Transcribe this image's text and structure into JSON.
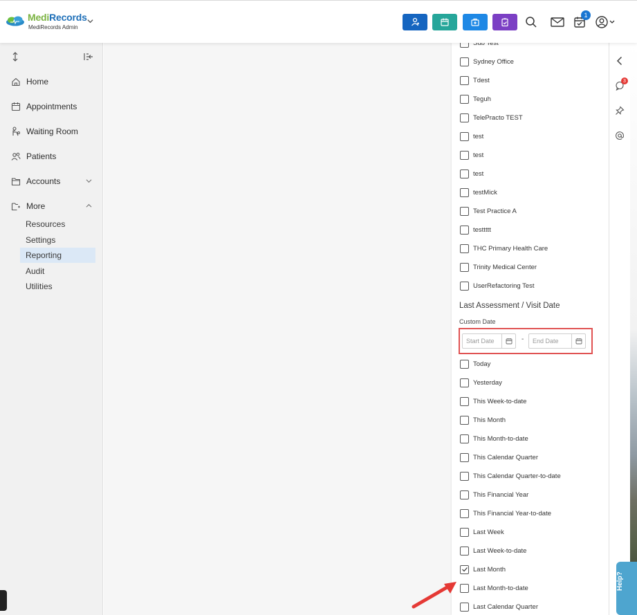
{
  "app": {
    "name_part1": "Medi",
    "name_part2": "Records",
    "subtitle": "MediRecords Admin",
    "brand_colors": {
      "green": "#7cb342",
      "blue": "#1e6fb8"
    }
  },
  "topbar": {
    "action_buttons": [
      {
        "icon": "add-patient-icon",
        "color": "#1565c0"
      },
      {
        "icon": "calendar-icon",
        "color": "#26a69a"
      },
      {
        "icon": "medical-bag-icon",
        "color": "#1e88e5"
      },
      {
        "icon": "clipboard-icon",
        "color": "#7b3fc4"
      }
    ],
    "icons": [
      "search-icon",
      "mail-icon",
      "tasks-icon",
      "user-icon"
    ],
    "tasks_badge": "1"
  },
  "sidebar": {
    "nav": [
      {
        "label": "Home",
        "icon": "home-icon"
      },
      {
        "label": "Appointments",
        "icon": "calendar-icon"
      },
      {
        "label": "Waiting Room",
        "icon": "waiting-room-icon"
      },
      {
        "label": "Patients",
        "icon": "patients-icon"
      },
      {
        "label": "Accounts",
        "icon": "folder-icon"
      },
      {
        "label": "More",
        "icon": "folder-more-icon"
      }
    ],
    "submenu": [
      {
        "label": "Resources"
      },
      {
        "label": "Settings"
      },
      {
        "label": "Reporting",
        "active": true
      },
      {
        "label": "Audit"
      },
      {
        "label": "Utilities"
      }
    ]
  },
  "filter_panel": {
    "practices": [
      {
        "label": "Sub Test",
        "checked": false
      },
      {
        "label": "Sydney Office",
        "checked": false
      },
      {
        "label": "Tdest",
        "checked": false
      },
      {
        "label": "Teguh",
        "checked": false
      },
      {
        "label": "TelePracto TEST",
        "checked": false
      },
      {
        "label": "test",
        "checked": false
      },
      {
        "label": "test",
        "checked": false
      },
      {
        "label": "test",
        "checked": false
      },
      {
        "label": "testMick",
        "checked": false
      },
      {
        "label": "Test Practice A",
        "checked": false
      },
      {
        "label": "testtttt",
        "checked": false
      },
      {
        "label": "THC Primary Health Care",
        "checked": false
      },
      {
        "label": "Trinity Medical Center",
        "checked": false
      },
      {
        "label": "UserRefactoring Test",
        "checked": false
      }
    ],
    "section_title": "Last Assessment / Visit Date",
    "custom_date_label": "Custom Date",
    "start_date_placeholder": "Start Date",
    "end_date_placeholder": "End Date",
    "date_separator": "-",
    "date_ranges": [
      {
        "label": "Today",
        "checked": false
      },
      {
        "label": "Yesterday",
        "checked": false
      },
      {
        "label": "This Week-to-date",
        "checked": false
      },
      {
        "label": "This Month",
        "checked": false
      },
      {
        "label": "This Month-to-date",
        "checked": false
      },
      {
        "label": "This Calendar Quarter",
        "checked": false
      },
      {
        "label": "This Calendar Quarter-to-date",
        "checked": false
      },
      {
        "label": "This Financial Year",
        "checked": false
      },
      {
        "label": "This Financial Year-to-date",
        "checked": false
      },
      {
        "label": "Last Week",
        "checked": false
      },
      {
        "label": "Last Week-to-date",
        "checked": false
      },
      {
        "label": "Last Month",
        "checked": true
      },
      {
        "label": "Last Month-to-date",
        "checked": false
      },
      {
        "label": "Last Calendar Quarter",
        "checked": false
      }
    ]
  },
  "right_strip": {
    "icons": [
      "chevron-left-icon",
      "chat-icon",
      "pin-icon",
      "at-icon"
    ],
    "chat_badge": "3"
  },
  "help_tab": {
    "label": "Help?"
  },
  "annotations": {
    "highlight_color": "#e05252",
    "arrow_color": "#e53935"
  }
}
